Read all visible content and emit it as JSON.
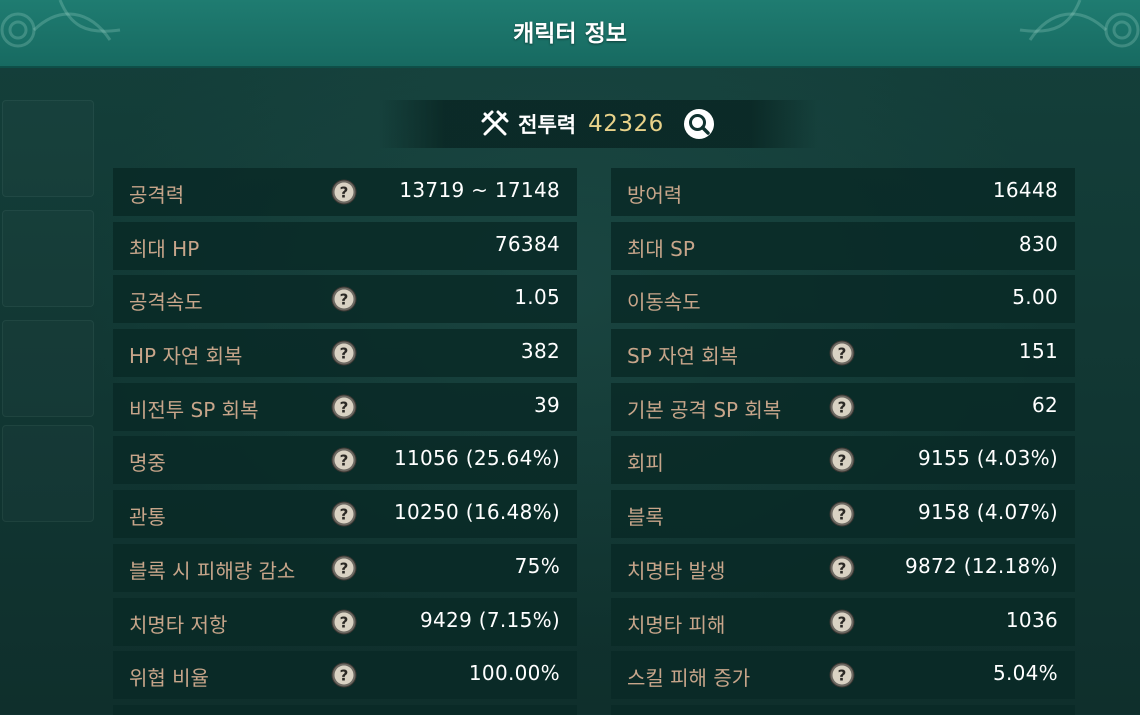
{
  "header": {
    "title": "캐릭터 정보"
  },
  "combat_power": {
    "label": "전투력",
    "value": "42326",
    "icon": "crossed-swords-icon",
    "search_icon": "magnifier-icon"
  },
  "left_stats": [
    {
      "label": "공격력",
      "help": true,
      "value": "13719 ~ 17148"
    },
    {
      "label": "최대 HP",
      "help": false,
      "value": "76384"
    },
    {
      "label": "공격속도",
      "help": true,
      "value": "1.05"
    },
    {
      "label": "HP 자연 회복",
      "help": true,
      "value": "382"
    },
    {
      "label": "비전투 SP 회복",
      "help": true,
      "value": "39"
    },
    {
      "label": "명중",
      "help": true,
      "value": "11056 (25.64%)"
    },
    {
      "label": "관통",
      "help": true,
      "value": "10250 (16.48%)"
    },
    {
      "label": "블록 시 피해량 감소",
      "help": true,
      "value": "75%"
    },
    {
      "label": "치명타 저항",
      "help": true,
      "value": "9429 (7.15%)"
    },
    {
      "label": "위협 비율",
      "help": true,
      "value": "100.00%"
    }
  ],
  "right_stats": [
    {
      "label": "방어력",
      "help": false,
      "value": "16448"
    },
    {
      "label": "최대 SP",
      "help": false,
      "value": "830"
    },
    {
      "label": "이동속도",
      "help": false,
      "value": "5.00"
    },
    {
      "label": "SP 자연 회복",
      "help": true,
      "value": "151"
    },
    {
      "label": "기본 공격 SP 회복",
      "help": true,
      "value": "62"
    },
    {
      "label": "회피",
      "help": true,
      "value": "9155 (4.03%)"
    },
    {
      "label": "블록",
      "help": true,
      "value": "9158 (4.07%)"
    },
    {
      "label": "치명타 발생",
      "help": true,
      "value": "9872 (12.18%)"
    },
    {
      "label": "치명타 피해",
      "help": true,
      "value": "1036"
    },
    {
      "label": "스킬 피해 증가",
      "help": true,
      "value": "5.04%"
    }
  ],
  "colors": {
    "header_bg": "#1f7c71",
    "row_bg": "#0a2a27",
    "label": "#c7a58a",
    "value": "#ffffff",
    "cp_value": "#e8d28a"
  }
}
